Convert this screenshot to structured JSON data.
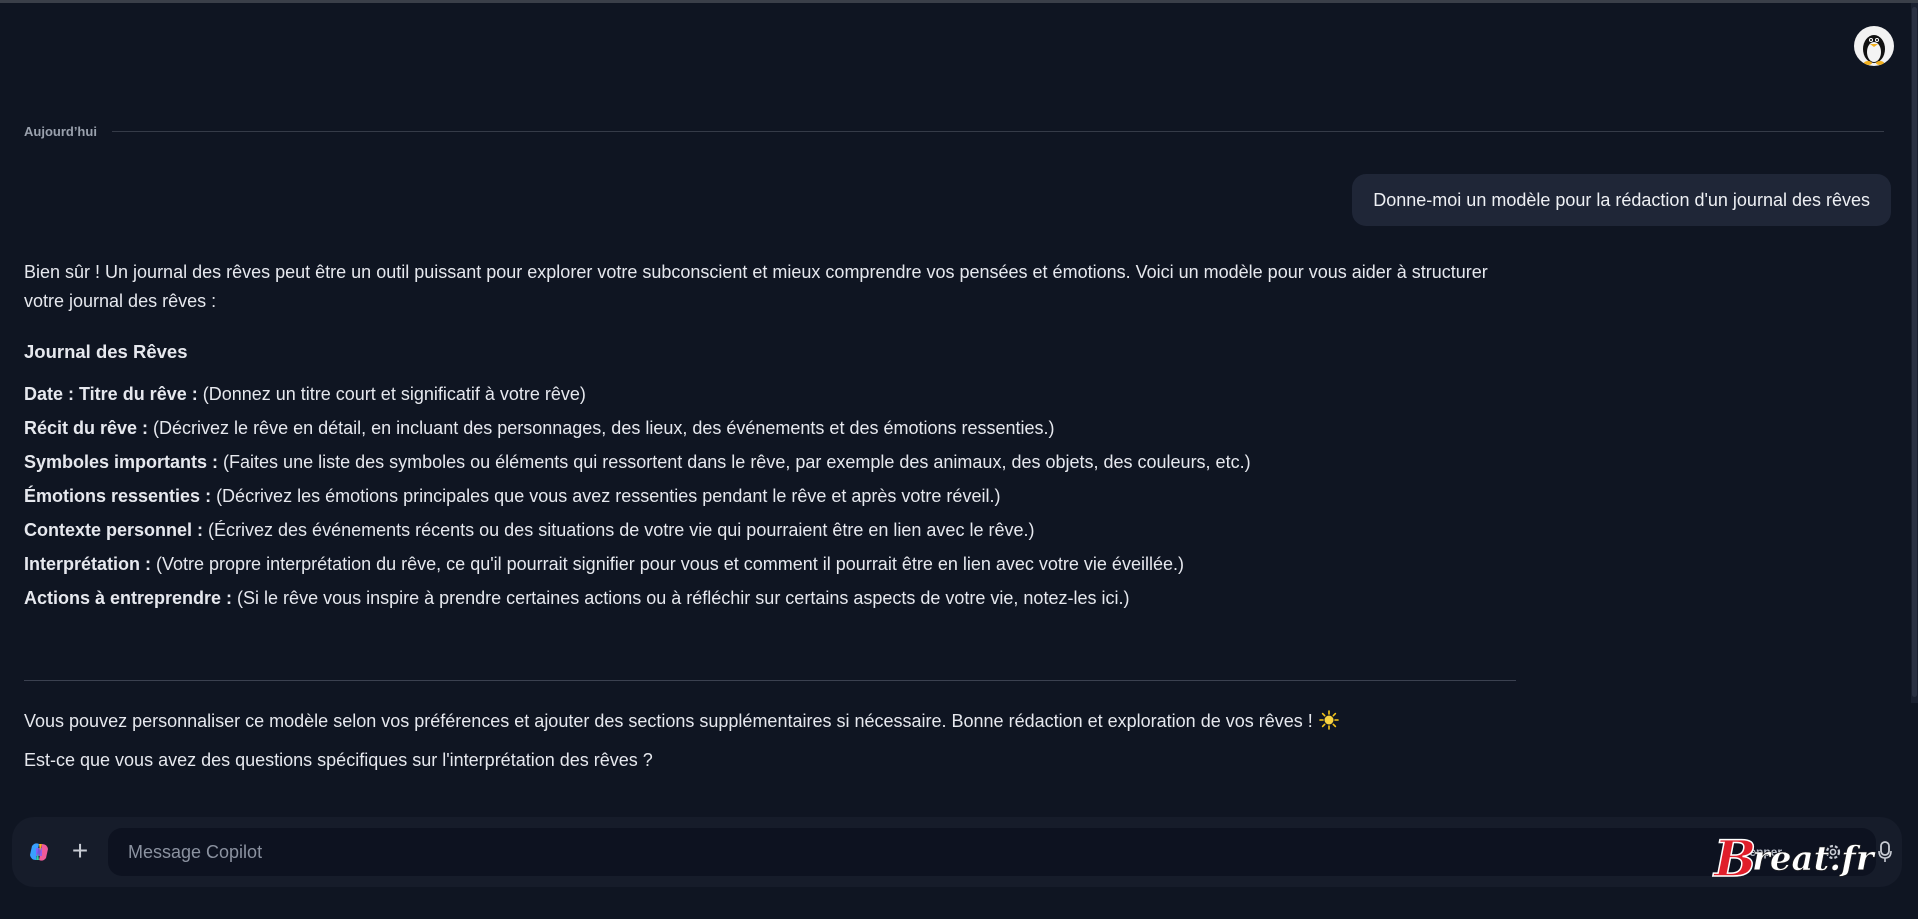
{
  "header": {
    "avatar_icon": "penguin-icon"
  },
  "conversation": {
    "day_label": "Aujourd’hui",
    "user_message": "Donne-moi un modèle pour la rédaction d'un journal des rêves",
    "assistant": {
      "intro": "Bien sûr ! Un journal des rêves peut être un outil puissant pour explorer votre subconscient et mieux comprendre vos pensées et émotions. Voici un modèle pour vous aider à structurer votre journal des rêves :",
      "heading": "Journal des Rêves",
      "fields": [
        {
          "label": "Date : Titre du rêve :",
          "text": " (Donnez un titre court et significatif à votre rêve)"
        },
        {
          "label": "Récit du rêve :",
          "text": " (Décrivez le rêve en détail, en incluant des personnages, des lieux, des événements et des émotions ressenties.)"
        },
        {
          "label": "Symboles importants :",
          "text": " (Faites une liste des symboles ou éléments qui ressortent dans le rêve, par exemple des animaux, des objets, des couleurs, etc.)"
        },
        {
          "label": "Émotions ressenties :",
          "text": " (Décrivez les émotions principales que vous avez ressenties pendant le rêve et après votre réveil.)"
        },
        {
          "label": "Contexte personnel :",
          "text": " (Écrivez des événements récents ou des situations de votre vie qui pourraient être en lien avec le rêve.)"
        },
        {
          "label": "Interprétation :",
          "text": " (Votre propre interprétation du rêve, ce qu'il pourrait signifier pour vous et comment il pourrait être en lien avec votre vie éveillée.)"
        },
        {
          "label": "Actions à entreprendre :",
          "text": " (Si le rêve vous inspire à prendre certaines actions ou à réfléchir sur certains aspects de votre vie, notez-les ici.)"
        }
      ],
      "outro_1": "Vous pouvez personnaliser ce modèle selon vos préférences et ajouter des sections supplémentaires si nécessaire. Bonne rédaction et exploration de vos rêves !",
      "outro_emoji_icon": "sun-icon",
      "outro_2": "Est-ce que vous avez des questions spécifiques sur l'interprétation des rêves ?"
    }
  },
  "composer": {
    "placeholder": "Message Copilot",
    "voice_label": "pepper",
    "icons": [
      "copilot-logo-icon",
      "plus-icon",
      "gear-icon",
      "microphone-icon"
    ]
  },
  "watermark": {
    "text": "Breat.fr"
  },
  "colors": {
    "background": "#0f1522",
    "user_bubble": "#1f2637",
    "composer": "#161c2a",
    "watermark_red": "#e01e2a"
  }
}
